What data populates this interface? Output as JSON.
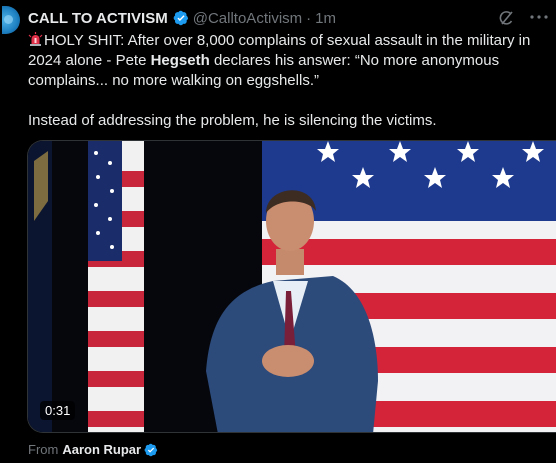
{
  "tweet": {
    "author_name": "CALL TO ACTIVISM",
    "handle": "@CalltoActivism",
    "separator": "·",
    "time": "1m",
    "text_line1_a": "HOLY SHIT: After over 8,000 complains of sexual assault in the military in 2024 alone - Pete ",
    "text_line1_bold": "Hegseth",
    "text_line1_b": " declares his answer: “No more anonymous complains... no more walking on eggshells.”",
    "text_line2": "Instead of addressing the problem, he is silencing the victims."
  },
  "video": {
    "duration": "0:31"
  },
  "attribution": {
    "prefix": "From",
    "name": "Aaron Rupar"
  },
  "colors": {
    "background": "#000000",
    "text_primary": "#e7e9ea",
    "text_secondary": "#71767b",
    "verified_blue": "#1d9bf0",
    "alert_red": "#e0314b"
  },
  "icons": [
    "verified-badge-icon",
    "grok-icon",
    "more-options-icon",
    "rotating-light-icon"
  ]
}
